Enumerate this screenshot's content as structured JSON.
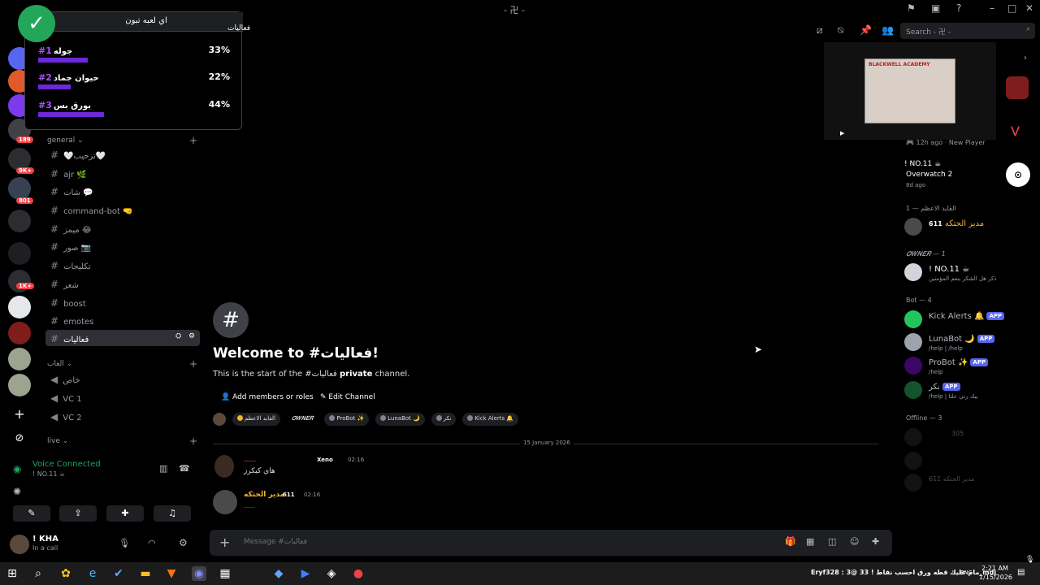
{
  "titlebar": {
    "title": "- 卍 -"
  },
  "poll": {
    "title": "اي لعبه تبون",
    "options": [
      {
        "rank": "#1",
        "name": "جوله",
        "percent": "33%",
        "value": 33
      },
      {
        "rank": "#2",
        "name": "حيوان جماد",
        "percent": "22%",
        "value": 22
      },
      {
        "rank": "#3",
        "name": "بورق بس",
        "percent": "44%",
        "value": 44
      }
    ]
  },
  "rail": {
    "badges": [
      "189",
      "9K+",
      "801",
      "1K+"
    ]
  },
  "sidebar": {
    "category_general": "general",
    "channels": [
      {
        "label": "🤍ترحيب🤍"
      },
      {
        "label": "ajr 🌿"
      },
      {
        "label": "شات 💬"
      },
      {
        "label": "command-bot 🤜"
      },
      {
        "label": "ميمز 😂"
      },
      {
        "label": "صور 📷"
      },
      {
        "label": "تكليجات"
      },
      {
        "label": "شعر"
      },
      {
        "label": "boost"
      },
      {
        "label": "emotes"
      },
      {
        "label": "فعاليات"
      }
    ],
    "category_voice": "العاب",
    "voice_channels": [
      {
        "label": "خاص"
      },
      {
        "label": "VC 1"
      },
      {
        "label": "VC 2"
      }
    ],
    "category_live": "live"
  },
  "voice_panel": {
    "title": "Voice Connected",
    "subtitle": "! NO.11 ☕"
  },
  "user": {
    "name": "! KHA",
    "status": "In a call"
  },
  "header": {
    "channel": "فعاليات",
    "search_placeholder": "Search - 卍 -"
  },
  "welcome": {
    "title": "Welcome to #فعاليات!",
    "sub_start": "This is the start of the #فعاليات",
    "sub_bold": "private",
    "sub_end": "channel.",
    "add_members": "Add members or roles",
    "edit_channel": "Edit Channel"
  },
  "role_chips": [
    "القايد الاعظم",
    "𝑶𝑾𝑵𝑬𝑹",
    "ProBot ✨",
    "LunaBot 🌙",
    "نكر",
    "Kick Alerts 🔔"
  ],
  "date_divider": "15 January 2026",
  "messages": [
    {
      "author": "ـــــ",
      "tag": "Xeno",
      "time": "02:16",
      "text": "هاي كيكرز"
    },
    {
      "author": "مدير الحتكه",
      "tag": "611",
      "time": "02:16",
      "text": "ـــــ"
    }
  ],
  "composer": {
    "placeholder": "Message #فعاليات"
  },
  "members": {
    "activity_1": {
      "time": "12h ago",
      "text": "New Player"
    },
    "activity_2": {
      "name": "! NO.11 ☕",
      "game": "Overwatch 2",
      "time": "8d ago"
    },
    "group_1": "القايد الاعظم — 1",
    "m1": {
      "name": "مدير الحتكه",
      "tag": "611"
    },
    "group_2": "𝑶𝑾𝑵𝑬𝑹 — 1",
    "m2": {
      "name": "! NO.11 ☕",
      "status": "ذكر هل الشكر ينعم المؤمنين"
    },
    "group_bots": "Bot — 4",
    "bots": [
      {
        "name": "Kick Alerts 🔔",
        "app": "APP",
        "status": ""
      },
      {
        "name": "LunaBot 🌙",
        "app": "APP",
        "status": "/help | /help"
      },
      {
        "name": "ProBot ✨",
        "app": "APP",
        "status": "/help"
      },
      {
        "name": "نكر",
        "app": "APP",
        "status": "/help | بيك رني علثا"
      }
    ],
    "group_offline": "Offline — 3",
    "offline": [
      {
        "name": "305"
      },
      {
        "name": ""
      },
      {
        "name": "مدير الحتكه 611"
      }
    ]
  },
  "stream": {
    "label": "BLACKWELL ACADEMY"
  },
  "taskbar": {
    "ticker": "Eryf328 : 3@ مام عليك قطه ورق احسب نقاط ! 33_mdj",
    "lang": "ENG",
    "time": "2:21 AM",
    "date": "1/15/2026"
  }
}
